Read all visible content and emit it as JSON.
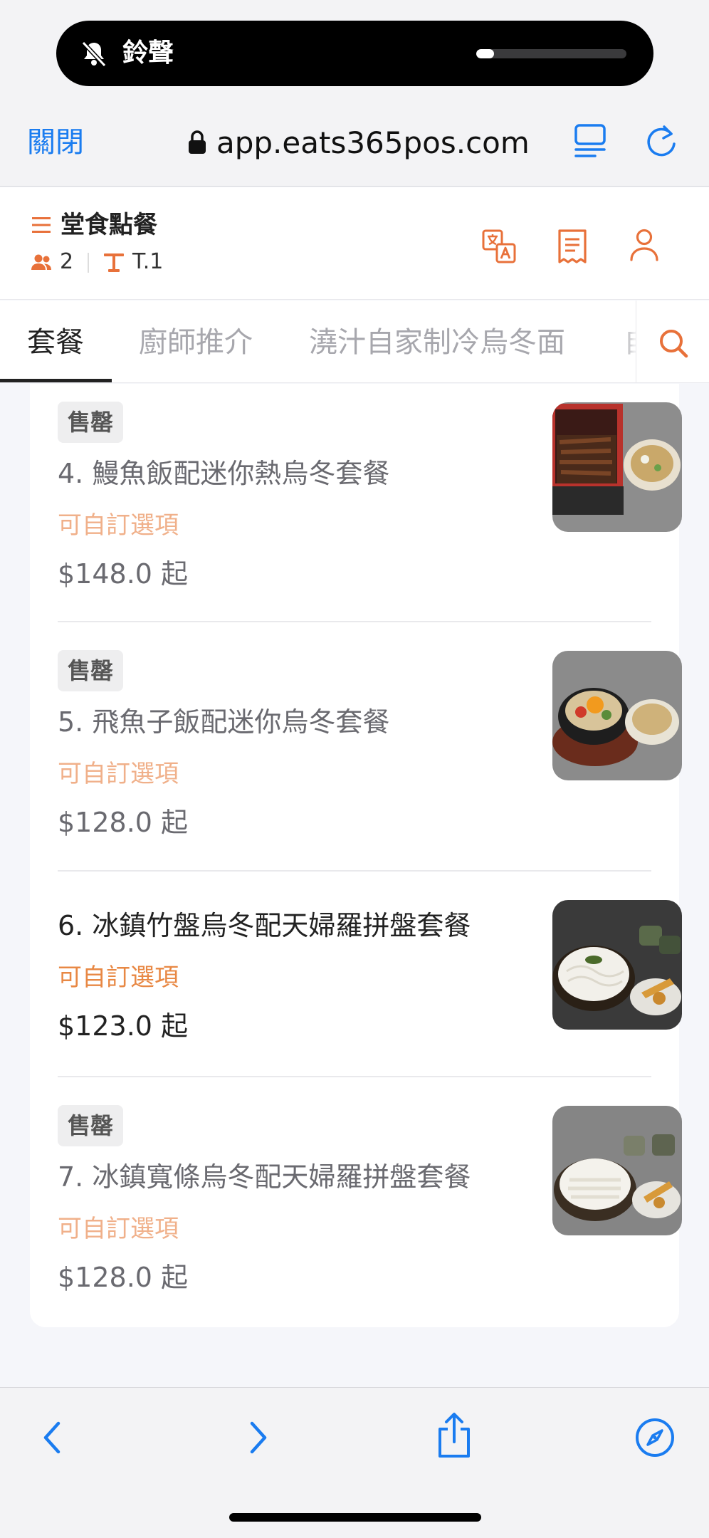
{
  "status": {
    "mode_label": "鈴聲",
    "volume_level": 0.12
  },
  "browser": {
    "close_label": "關閉",
    "url": "app.eats365pos.com",
    "accent": "#1a7cf0"
  },
  "header": {
    "mode_title": "堂食點餐",
    "guest_count": "2",
    "table_label": "T.1",
    "accent": "#e8713a"
  },
  "tabs": [
    {
      "label": "套餐",
      "active": true
    },
    {
      "label": "廚師推介",
      "active": false
    },
    {
      "label": "澆汁自家制冷烏冬面",
      "active": false
    },
    {
      "label": "自",
      "active": false
    }
  ],
  "menu": {
    "sold_out_label": "售罄",
    "items": [
      {
        "name": "4. 鰻魚飯配迷你熱烏冬套餐",
        "option": "可自訂選項",
        "price": "$148.0 起",
        "sold_out": true,
        "image": "unagi-rice-udon-set"
      },
      {
        "name": "5. 飛魚子飯配迷你烏冬套餐",
        "option": "可自訂選項",
        "price": "$128.0 起",
        "sold_out": true,
        "image": "tobiko-rice-udon-set"
      },
      {
        "name": "6. 冰鎮竹盤烏冬配天婦羅拼盤套餐",
        "option": "可自訂選項",
        "price": "$123.0 起",
        "sold_out": false,
        "image": "zaru-udon-tempura-set"
      },
      {
        "name": "7. 冰鎮寬條烏冬配天婦羅拼盤套餐",
        "option": "可自訂選項",
        "price": "$128.0 起",
        "sold_out": true,
        "image": "wide-udon-tempura-set"
      }
    ]
  }
}
